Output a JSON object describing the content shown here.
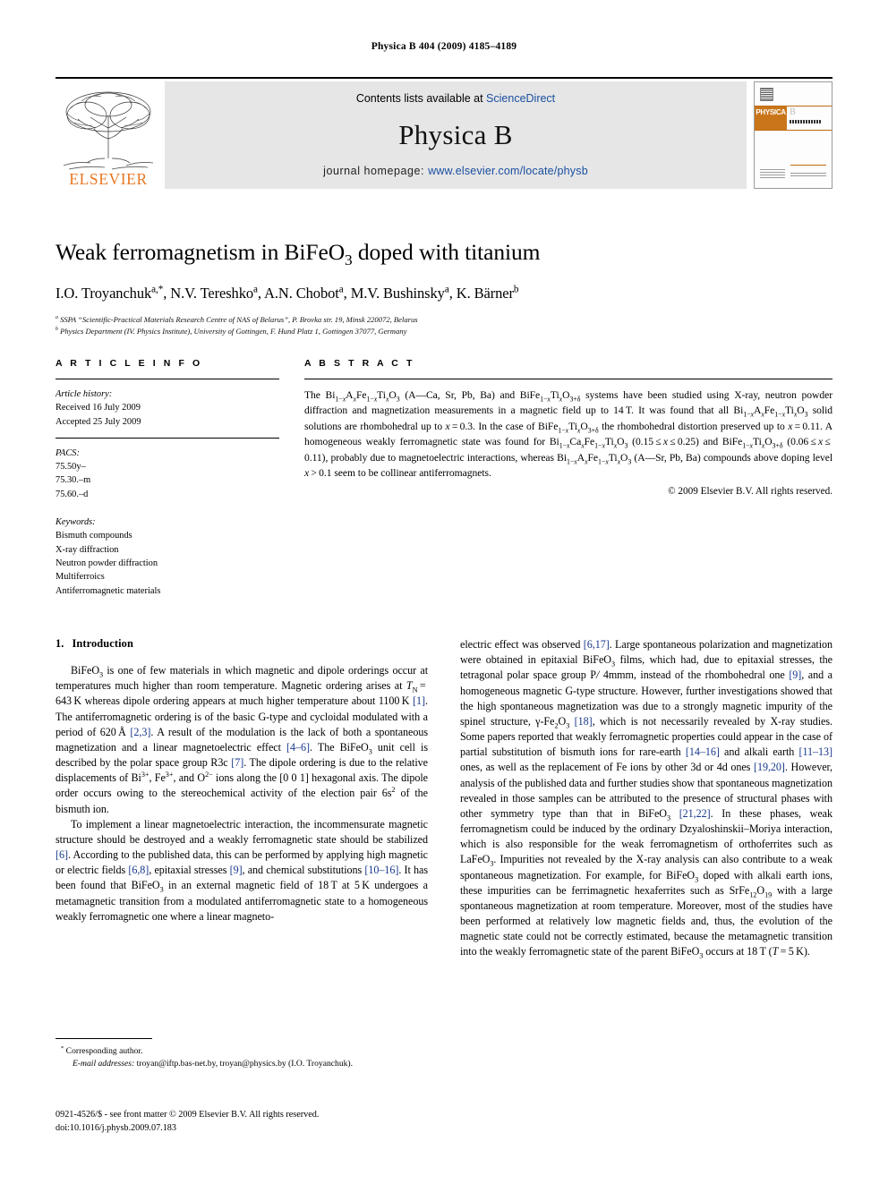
{
  "running_head": "Physica B 404 (2009) 4185–4189",
  "masthead": {
    "contents_prefix": "Contents lists available at ",
    "sciencedirect": "ScienceDirect",
    "journal_name": "Physica B",
    "homepage_prefix": "journal homepage: ",
    "homepage_url": "www.elsevier.com/locate/physb",
    "publisher": "ELSEVIER",
    "cover_band_left": "PHYSICA",
    "cover_band_right": "B",
    "accent_color": "#E87722",
    "link_color": "#1a4fa0"
  },
  "title_block": {
    "title_parts": [
      "Weak ferromagnetism in BiFeO",
      "3",
      " doped with titanium"
    ],
    "authors": "I.O. Troyanchuk a,*, N.V. Tereshko a, A.N. Chobot a, M.V. Bushinsky a, K. Bärner b",
    "affiliation_a": "SSPA “Scientific-Practical Materials Research Centre of NAS of Belarus”, P. Brovka str. 19, Minsk 220072, Belarus",
    "affiliation_b": "Physics Department (IV. Physics Institute), University of Gottingen, F. Hund Platz 1, Gottingen 37077, Germany"
  },
  "article_info": {
    "heading": "A R T I C L E    I N F O",
    "history_label": "Article history:",
    "history": [
      "Received 16 July 2009",
      "Accepted 25 July 2009"
    ],
    "pacs_label": "PACS:",
    "pacs": [
      "75.50y–",
      "75.30.–m",
      "75.60.–d"
    ],
    "keywords_label": "Keywords:",
    "keywords": [
      "Bismuth compounds",
      "X-ray diffraction",
      "Neutron powder diffraction",
      "Multiferroics",
      "Antiferromagnetic materials"
    ]
  },
  "abstract": {
    "heading": "A B S T R A C T",
    "copyright": "© 2009 Elsevier B.V. All rights reserved."
  },
  "introduction": {
    "number": "1.",
    "heading": "Introduction"
  },
  "footnotes": {
    "corresponding": "Corresponding author.",
    "email_label": "E-mail addresses:",
    "emails": "troyan@iftp.bas-net.by, troyan@physics.by (I.O. Troyanchuk)."
  },
  "imprint": {
    "line1": "0921-4526/$ - see front matter © 2009 Elsevier B.V. All rights reserved.",
    "line2": "doi:10.1016/j.physb.2009.07.183"
  }
}
